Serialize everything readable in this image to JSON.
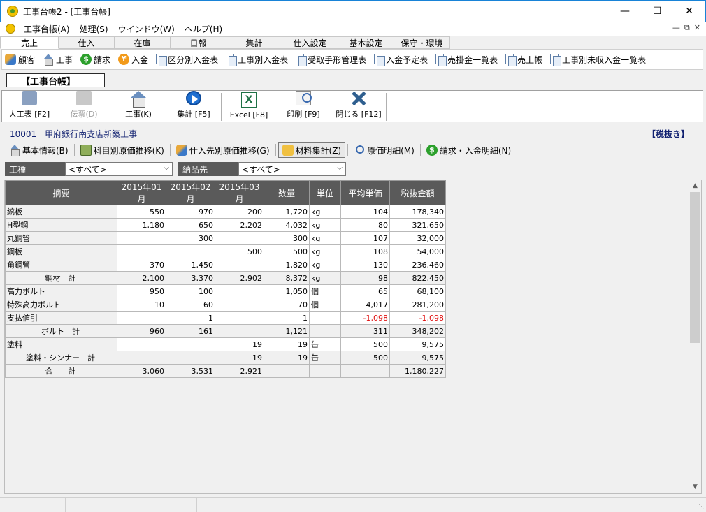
{
  "window": {
    "title": "工事台帳2 - [工事台帳]"
  },
  "menu": [
    "工事台帳(A)",
    "処理(S)",
    "ウインドウ(W)",
    "ヘルプ(H)"
  ],
  "ribbon_tabs": [
    "売上",
    "仕入",
    "在庫",
    "日報",
    "集計",
    "仕入設定",
    "基本設定",
    "保守・環境"
  ],
  "sub_toolbar": [
    {
      "label": "顧客",
      "icon": "people-icon"
    },
    {
      "label": "工事",
      "icon": "house-icon"
    },
    {
      "label": "請求",
      "icon": "dollar-icon"
    },
    {
      "label": "入金",
      "icon": "coin-icon"
    },
    {
      "label": "区分別入金表",
      "icon": "report-icon"
    },
    {
      "label": "工事別入金表",
      "icon": "report-icon"
    },
    {
      "label": "受取手形管理表",
      "icon": "report-icon"
    },
    {
      "label": "入金予定表",
      "icon": "report-icon"
    },
    {
      "label": "売掛金一覧表",
      "icon": "report-icon"
    },
    {
      "label": "売上帳",
      "icon": "report-icon"
    },
    {
      "label": "工事別未収入金一覧表",
      "icon": "report-icon"
    }
  ],
  "form_title": "【工事台帳】",
  "toolbar": {
    "labor": "人工表 [F2]",
    "slip": "伝票(D)",
    "project": "工事(K)",
    "total": "集計 [F5]",
    "excel": "Excel [F8]",
    "print": "印刷 [F9]",
    "close": "閉じる [F12]"
  },
  "project": {
    "line": "10001　甲府銀行南支店新築工事",
    "tax": "【税抜き】"
  },
  "detail_tabs": [
    "基本情報(B)",
    "科目別原価推移(K)",
    "仕入先別原価推移(G)",
    "材料集計(Z)",
    "原価明細(M)",
    "請求・入金明細(N)"
  ],
  "filters": {
    "kind_label": "工種",
    "kind_value": "<すべて>",
    "dest_label": "納品先",
    "dest_value": "<すべて>"
  },
  "table": {
    "headers": [
      "摘要",
      "2015年01月",
      "2015年02月",
      "2015年03月",
      "数量",
      "単位",
      "平均単価",
      "税抜金額"
    ],
    "rows": [
      {
        "name": "縞板",
        "c1": "550",
        "c2": "970",
        "c3": "200",
        "qty": "1,720",
        "unit": "kg",
        "avg": "104",
        "amt": "178,340"
      },
      {
        "name": "H型鋼",
        "c1": "1,180",
        "c2": "650",
        "c3": "2,202",
        "qty": "4,032",
        "unit": "kg",
        "avg": "80",
        "amt": "321,650"
      },
      {
        "name": "丸鋼管",
        "c1": "",
        "c2": "300",
        "c3": "",
        "qty": "300",
        "unit": "kg",
        "avg": "107",
        "amt": "32,000"
      },
      {
        "name": "鋼板",
        "c1": "",
        "c2": "",
        "c3": "500",
        "qty": "500",
        "unit": "kg",
        "avg": "108",
        "amt": "54,000"
      },
      {
        "name": "角鋼管",
        "c1": "370",
        "c2": "1,450",
        "c3": "",
        "qty": "1,820",
        "unit": "kg",
        "avg": "130",
        "amt": "236,460"
      },
      {
        "name": "鋼材　計",
        "c1": "2,100",
        "c2": "3,370",
        "c3": "2,902",
        "qty": "8,372",
        "unit": "kg",
        "avg": "98",
        "amt": "822,450",
        "subtotal": true
      },
      {
        "name": "高力ボルト",
        "c1": "950",
        "c2": "100",
        "c3": "",
        "qty": "1,050",
        "unit": "個",
        "avg": "65",
        "amt": "68,100"
      },
      {
        "name": "特殊高力ボルト",
        "c1": "10",
        "c2": "60",
        "c3": "",
        "qty": "70",
        "unit": "個",
        "avg": "4,017",
        "amt": "281,200"
      },
      {
        "name": "支払値引",
        "c1": "",
        "c2": "1",
        "c3": "",
        "qty": "1",
        "unit": "",
        "avg": "-1,098",
        "amt": "-1,098",
        "negative": true
      },
      {
        "name": "ボルト　計",
        "c1": "960",
        "c2": "161",
        "c3": "",
        "qty": "1,121",
        "unit": "",
        "avg": "311",
        "amt": "348,202",
        "subtotal": true
      },
      {
        "name": "塗料",
        "c1": "",
        "c2": "",
        "c3": "19",
        "qty": "19",
        "unit": "缶",
        "avg": "500",
        "amt": "9,575"
      },
      {
        "name": "塗料・シンナー　計",
        "c1": "",
        "c2": "",
        "c3": "19",
        "qty": "19",
        "unit": "缶",
        "avg": "500",
        "amt": "9,575",
        "subtotal": true
      },
      {
        "name": "合　　計",
        "c1": "3,060",
        "c2": "3,531",
        "c3": "2,921",
        "qty": "",
        "unit": "",
        "avg": "",
        "amt": "1,180,227",
        "subtotal": true
      }
    ]
  },
  "colors": {
    "header_bg": "#5a5a5a",
    "negative": "#e01010",
    "project_text": "#102070"
  }
}
